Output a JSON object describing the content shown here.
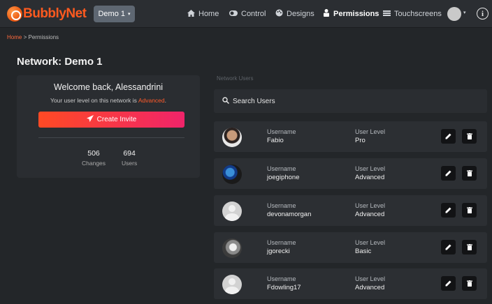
{
  "brand": {
    "name": "BubblyNet"
  },
  "network_selector": {
    "label": "Demo 1",
    "caret": "▾"
  },
  "nav": {
    "items": [
      {
        "label": "Home",
        "icon": "home-icon",
        "active": false
      },
      {
        "label": "Control",
        "icon": "toggle-icon",
        "active": false
      },
      {
        "label": "Designs",
        "icon": "palette-icon",
        "active": false
      },
      {
        "label": "Permissions",
        "icon": "user-shield-icon",
        "active": true
      },
      {
        "label": "Touchscreens",
        "icon": "touchscreen-icon",
        "active": false
      }
    ],
    "avatar_caret": "▾",
    "info_glyph": "i"
  },
  "breadcrumb": {
    "home": "Home",
    "separator": ">",
    "current": "Permissions"
  },
  "page": {
    "title": "Network: Demo 1"
  },
  "welcome": {
    "title": "Welcome back, Alessandrini",
    "level_prefix": "Your user level on this network is ",
    "level_value": "Advanced",
    "level_suffix": ".",
    "invite_button": "Create Invite",
    "stats": [
      {
        "value": "506",
        "label": "Changes"
      },
      {
        "value": "694",
        "label": "Users"
      }
    ]
  },
  "users_panel": {
    "header": "Network Users",
    "search_placeholder": "Search Users",
    "username_label": "Username",
    "level_label": "User Level",
    "users": [
      {
        "username": "Fabio",
        "level": "Pro",
        "avatar": "photo"
      },
      {
        "username": "joegiphone",
        "level": "Advanced",
        "avatar": "photo"
      },
      {
        "username": "devonamorgan",
        "level": "Advanced",
        "avatar": "default"
      },
      {
        "username": "jgorecki",
        "level": "Basic",
        "avatar": "photo"
      },
      {
        "username": "Fdowling17",
        "level": "Advanced",
        "avatar": "default"
      }
    ]
  },
  "colors": {
    "accent": "#ff5a2a",
    "invite_gradient_start": "#ff4a24",
    "invite_gradient_end": "#f0246a",
    "background": "#232629",
    "card": "#2a2d31"
  }
}
